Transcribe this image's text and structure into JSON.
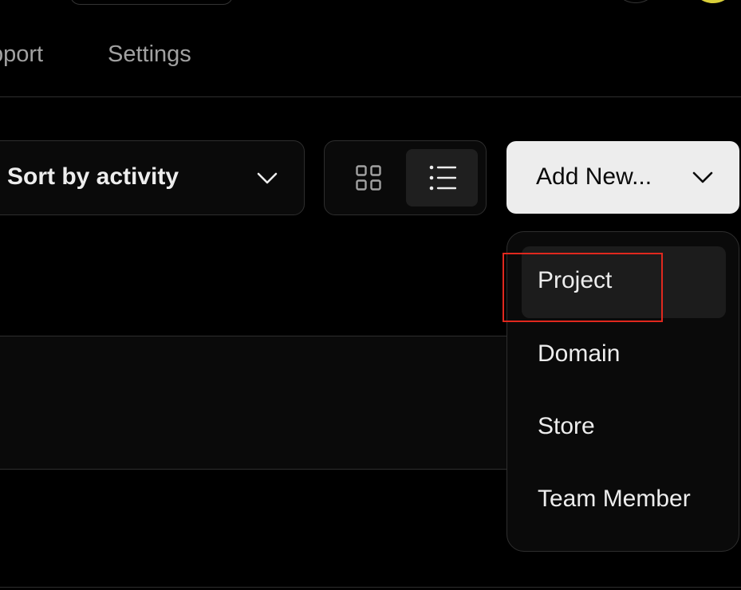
{
  "nav": {
    "tabs": [
      {
        "label": "pport"
      },
      {
        "label": "Settings"
      }
    ]
  },
  "toolbar": {
    "sort": {
      "label": "Sort by activity",
      "icon": "chevron-down-icon"
    },
    "view_toggle": {
      "grid_icon": "grid-icon",
      "list_icon": "list-icon",
      "active": "list"
    },
    "add_new": {
      "label": "Add New...",
      "icon": "chevron-down-icon"
    }
  },
  "menu": {
    "items": [
      {
        "label": "Project",
        "active": true
      },
      {
        "label": "Domain",
        "active": false
      },
      {
        "label": "Store",
        "active": false
      },
      {
        "label": "Team Member",
        "active": false
      }
    ]
  },
  "colors": {
    "background": "#000000",
    "surface": "#0a0a0a",
    "border": "#2e2e2e",
    "text": "#ededed",
    "muted": "#a1a1a1",
    "button_bg": "#ededed",
    "highlight": "#e0281e",
    "avatar": "#d9cf3a"
  }
}
